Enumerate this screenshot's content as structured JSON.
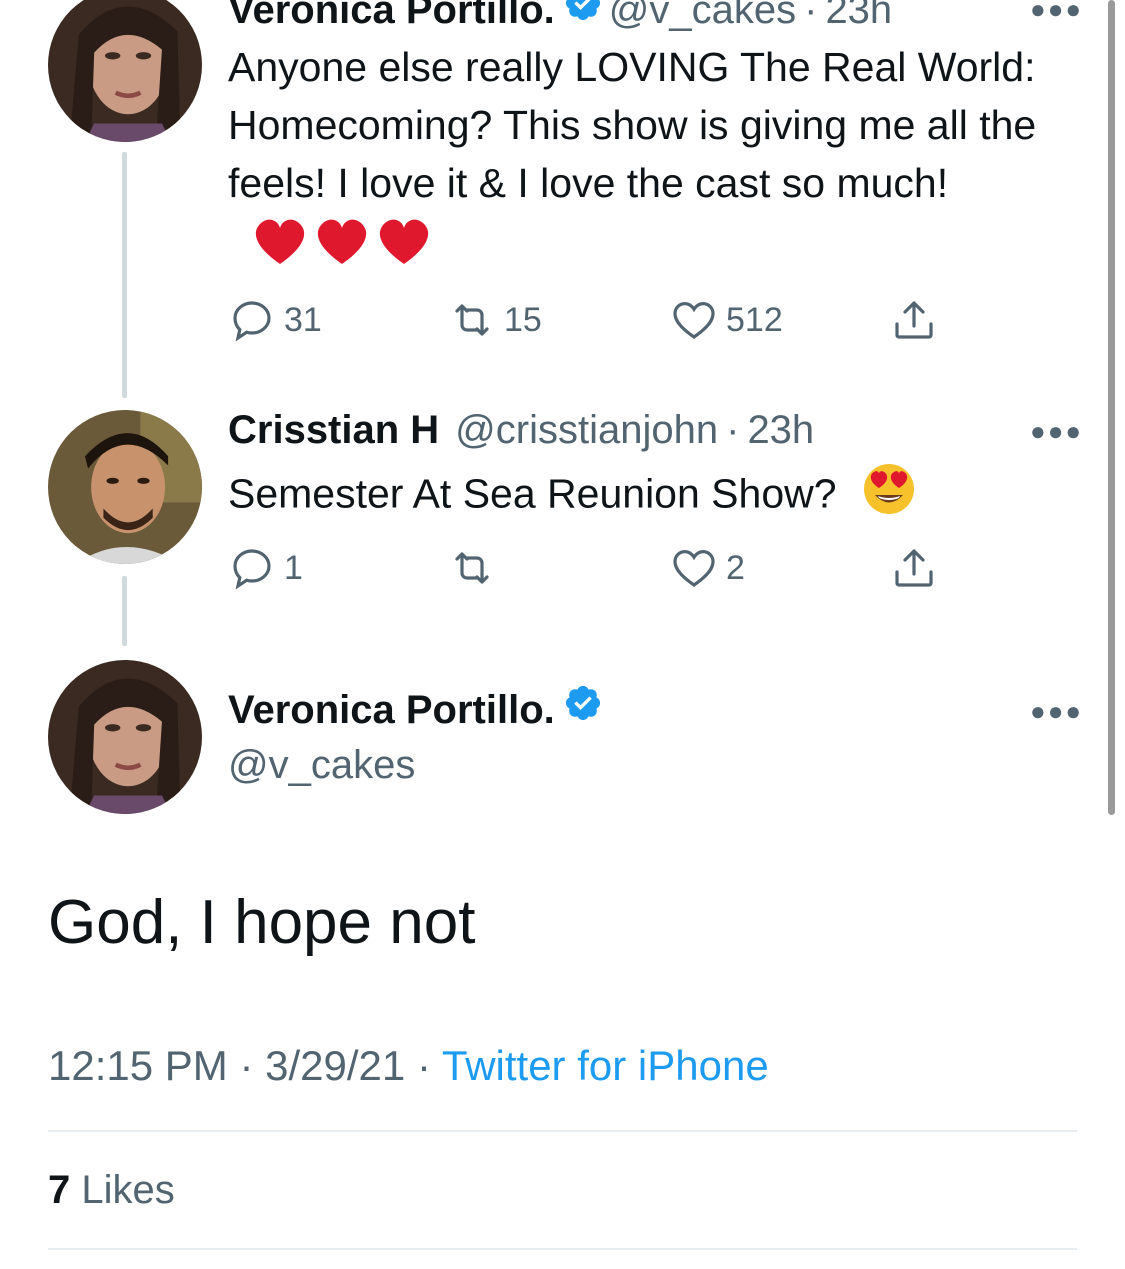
{
  "colors": {
    "text_primary": "#0f1419",
    "text_secondary": "#536471",
    "link_blue": "#1d9bf0",
    "verified_blue": "#1d9bf0",
    "thread_line": "#cfd9de",
    "heart_red": "#e0182d"
  },
  "tweet1": {
    "name": "Veronica Portillo.",
    "handle": "@v_cakes",
    "dot": "·",
    "time": "23h",
    "text": "Anyone else really LOVING The Real World: Homecoming?  This show is giving me all the feels!  I love it & I love the cast so much!",
    "emoji": "red-heart-emoji x3",
    "replies": "31",
    "retweets": "15",
    "likes": "512",
    "icons": [
      "verified-badge-icon",
      "more-icon",
      "reply-icon",
      "retweet-icon",
      "like-icon",
      "share-icon"
    ]
  },
  "tweet2": {
    "name": "Crisstian H",
    "handle": "@crisstianjohn",
    "dot": "·",
    "time": "23h",
    "text": "Semester At Sea Reunion Show?",
    "emoji": "heart-eyes-emoji",
    "replies": "1",
    "retweets": "",
    "likes": "2"
  },
  "main_tweet": {
    "name": "Veronica Portillo.",
    "handle": "@v_cakes",
    "text": "God, I hope not",
    "time": "12:15 PM",
    "sep1": "·",
    "date": "3/29/21",
    "sep2": "·",
    "source": "Twitter for iPhone",
    "likes_count": "7",
    "likes_label": "Likes"
  }
}
